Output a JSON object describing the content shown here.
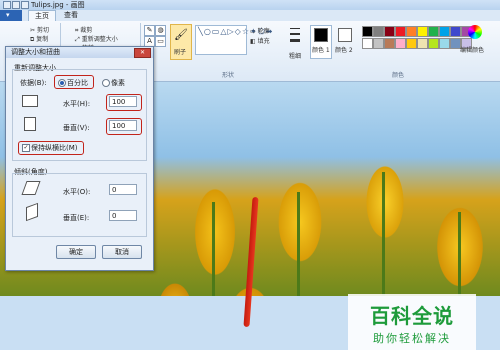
{
  "window": {
    "title": "Tulips.jpg - 画图"
  },
  "tabs": {
    "home": "主页",
    "view": "查看"
  },
  "ribbon": {
    "clipboard": {
      "cut": "剪切",
      "copy": "复制",
      "paste": "粘贴"
    },
    "image": {
      "crop": "裁剪",
      "resize": "重新调整大小",
      "rotate": "旋转"
    },
    "brush": "刷子",
    "shapes_group": "形状",
    "outline": "轮廓",
    "fill": "填充",
    "size": "粗细",
    "color1": "颜色 1",
    "color2": "颜色 2",
    "colors_group": "颜色",
    "edit_colors": "编辑颜色"
  },
  "dialog": {
    "title": "调整大小和扭曲",
    "close": "✕",
    "resize": {
      "legend": "重新调整大小",
      "by_label": "依据(B):",
      "percent": "百分比",
      "pixels": "像素",
      "horizontal_label": "水平(H):",
      "horizontal_value": "100",
      "vertical_label": "垂直(V):",
      "vertical_value": "100",
      "maintain_ratio": "保持纵横比(M)"
    },
    "skew": {
      "legend": "倾斜(角度)",
      "horizontal_label": "水平(O):",
      "horizontal_value": "0",
      "vertical_label": "垂直(E):",
      "vertical_value": "0"
    },
    "ok": "确定",
    "cancel": "取消"
  },
  "watermark": {
    "main": "百科全说",
    "sub": "助你轻松解决"
  },
  "palette": [
    "#000000",
    "#7f7f7f",
    "#880015",
    "#ed1c24",
    "#ff7f27",
    "#fff200",
    "#22b14c",
    "#00a2e8",
    "#3f48cc",
    "#a349a4",
    "#ffffff",
    "#c3c3c3",
    "#b97a57",
    "#ffaec9",
    "#ffc90e",
    "#efe4b0",
    "#b5e61d",
    "#99d9ea",
    "#7092be",
    "#c8bfe7"
  ],
  "colors": {
    "accent": "#2c64b4",
    "highlight_border": "#c2241b",
    "watermark": "#1e9b3b"
  }
}
